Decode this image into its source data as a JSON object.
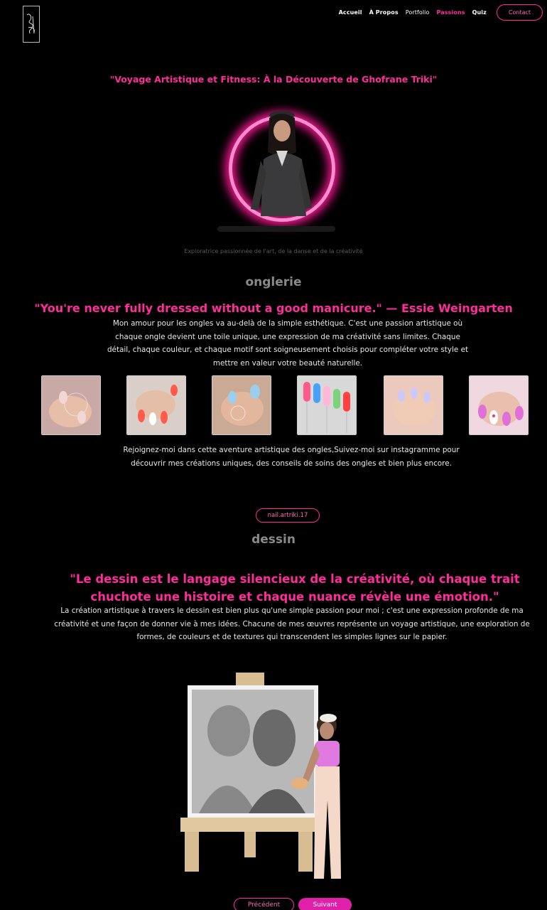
{
  "nav": {
    "items": [
      {
        "label": "Accueil"
      },
      {
        "label": "À Propos"
      },
      {
        "label": "Portfolio"
      },
      {
        "label": "Passions"
      },
      {
        "label": "Quiz"
      }
    ],
    "contact_label": "Contact",
    "active": "Passions"
  },
  "hero": {
    "title": "\"Voyage Artistique et Fitness: À la Découverte de Ghofrane Triki\"",
    "subtitle": "Exploratrice passionnée de l'art, de la danse et de la créativité"
  },
  "onglerie": {
    "title": "onglerie",
    "quote": "\"You're never fully dressed without a good manicure.\" — Essie Weingarten",
    "intro": "Mon amour pour les ongles va au-delà de la simple esthétique. C'est une passion artistique où chaque ongle devient une toile unique, une expression de ma créativité sans limites. Chaque détail, chaque couleur, et chaque motif sont soigneusement choisis pour compléter votre style et mettre en valeur votre beauté naturelle.",
    "outro": "Rejoignez-moi dans cette aventure artistique des ongles,Suivez-moi sur instagramme pour découvrir mes créations uniques, des conseils de soins des ongles et bien plus encore.",
    "instagram_label": "nail.artriki.17"
  },
  "dessin": {
    "title": "dessin",
    "quote": "\"Le dessin est le langage silencieux de la créativité, où chaque trait chuchote une histoire et chaque nuance révèle une émotion.\"",
    "text": "La création artistique à travers le dessin est bien plus qu'une simple passion pour moi ; c'est une expression profonde de ma créativité et une façon de donner vie à mes idées. Chacune de mes œuvres représente un voyage artistique, une exploration de formes, de couleurs et de textures qui transcendent les simples lignes sur le papier."
  },
  "pager": {
    "prev_label": "Précédent",
    "next_label": "Suivant"
  },
  "colors": {
    "accent": "#ff2c9c",
    "background": "#000000"
  }
}
